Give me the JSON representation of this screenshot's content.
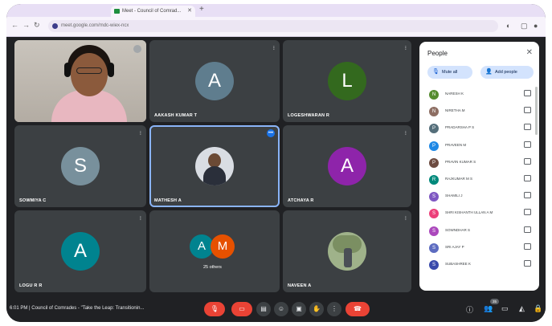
{
  "browser": {
    "tab_title": "Meet - Council of Comrad...",
    "url": "meet.google.com/mdc-wiex-ncx"
  },
  "tiles": [
    {
      "name": "",
      "kind": "camera"
    },
    {
      "name": "AAKASH KUMAR T",
      "initial": "A",
      "color": "#5f7d8e"
    },
    {
      "name": "LOGESHWARAN R",
      "initial": "L",
      "color": "#33691e"
    },
    {
      "name": "SOWMIYA C",
      "initial": "S",
      "color": "#78909c"
    },
    {
      "name": "MATHESH A",
      "kind": "photo"
    },
    {
      "name": "ATCHAYA R",
      "initial": "A",
      "color": "#8e24aa"
    },
    {
      "name": "LOGU R R",
      "initial": "A",
      "color": "#00838f"
    },
    {
      "name": "",
      "initial": "A",
      "initial2": "M",
      "color": "#00838f",
      "color2": "#e65100",
      "others_label": "25 others"
    },
    {
      "name": "NAVEEN A",
      "kind": "photo2"
    }
  ],
  "people_panel": {
    "title": "People",
    "mute_all": "Mute all",
    "add_people": "Add people",
    "people": [
      {
        "name": "NARESH K",
        "initial": "N",
        "color": "#558b2f"
      },
      {
        "name": "NIRETHA M",
        "initial": "N",
        "color": "#8d6e63"
      },
      {
        "name": "PRADARSHA P S",
        "initial": "P",
        "color": "#546e7a"
      },
      {
        "name": "PRAVEEN M",
        "initial": "P",
        "color": "#1e88e5"
      },
      {
        "name": "PRAVIN KUMAR S",
        "initial": "P",
        "color": "#6d4c41"
      },
      {
        "name": "RAJKUMAR M S",
        "initial": "R",
        "color": "#00897b"
      },
      {
        "name": "SHAMILI J",
        "initial": "S",
        "color": "#7e57c2"
      },
      {
        "name": "SHRI KISHANTH ULLAN A M",
        "initial": "S",
        "color": "#ec407a"
      },
      {
        "name": "SOWNDHAR S",
        "initial": "S",
        "color": "#ab47bc"
      },
      {
        "name": "SRI AJAY P",
        "initial": "S",
        "color": "#5c6bc0"
      },
      {
        "name": "SUBASHREE K",
        "initial": "S",
        "color": "#3949ab"
      }
    ]
  },
  "bottom_bar": {
    "time_meeting": "6:01 PM  |  Council of Comrades - \"Take the Leap: Transitionin...",
    "participant_count": "35"
  }
}
